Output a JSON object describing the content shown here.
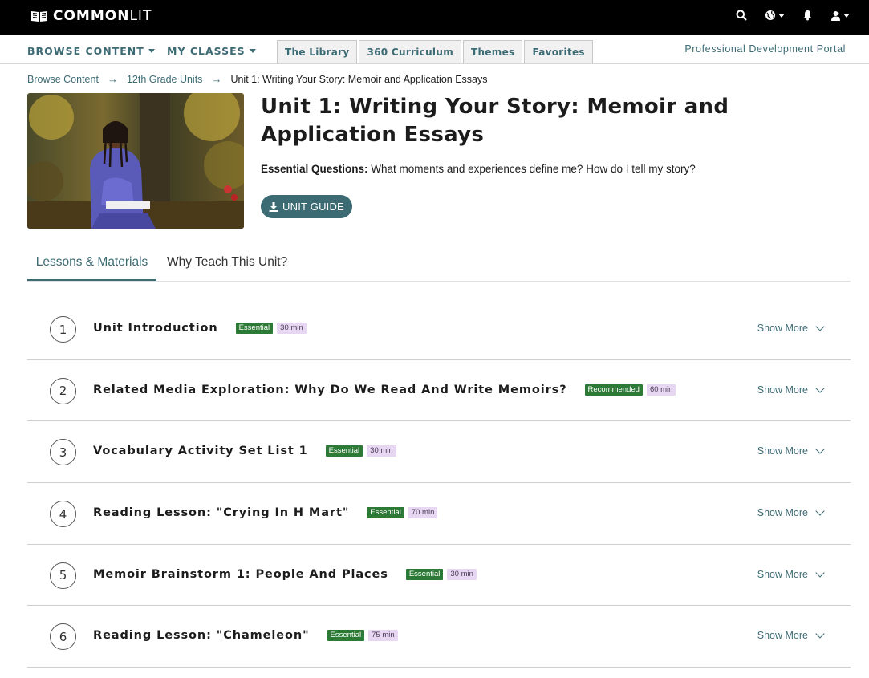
{
  "brand": {
    "name_bold": "COMMON",
    "name_light": "LIT"
  },
  "topbar_icons": [
    "search-icon",
    "globe-icon",
    "bell-icon",
    "user-icon"
  ],
  "nav": {
    "browse_content": "BROWSE CONTENT",
    "my_classes": "MY CLASSES",
    "tabs": [
      {
        "label": "The Library"
      },
      {
        "label": "360 Curriculum"
      },
      {
        "label": "Themes"
      },
      {
        "label": "Favorites"
      }
    ],
    "pd_portal": "Professional Development Portal"
  },
  "breadcrumb": {
    "items": [
      {
        "label": "Browse Content"
      },
      {
        "label": "12th Grade Units"
      },
      {
        "label": "Unit 1: Writing Your Story: Memoir and Application Essays"
      }
    ]
  },
  "unit": {
    "title": "Unit 1: Writing Your Story: Memoir and Application Essays",
    "essential_label": "Essential Questions:",
    "essential_text": " What moments and experiences define me? How do I tell my story?",
    "guide_label": "UNIT GUIDE"
  },
  "tabs": [
    {
      "label": "Lessons & Materials"
    },
    {
      "label": "Why Teach This Unit?"
    }
  ],
  "lessons": [
    {
      "num": "1",
      "title": "Unit Introduction",
      "type": "Essential",
      "time": "30 min",
      "show_more": "Show More"
    },
    {
      "num": "2",
      "title": "Related Media Exploration: Why Do We Read And Write Memoirs?",
      "type": "Recommended",
      "time": "60 min",
      "show_more": "Show More"
    },
    {
      "num": "3",
      "title": "Vocabulary Activity Set List 1",
      "type": "Essential",
      "time": "30 min",
      "show_more": "Show More"
    },
    {
      "num": "4",
      "title": "Reading Lesson: \"Crying In H Mart\"",
      "type": "Essential",
      "time": "70 min",
      "show_more": "Show More"
    },
    {
      "num": "5",
      "title": "Memoir Brainstorm 1: People And Places",
      "type": "Essential",
      "time": "30 min",
      "show_more": "Show More"
    },
    {
      "num": "6",
      "title": "Reading Lesson: \"Chameleon\"",
      "type": "Essential",
      "time": "75 min",
      "show_more": "Show More"
    }
  ],
  "colors": {
    "teal": "#3d6b74",
    "essential_green": "#2c7a35",
    "time_purple": "#e7d7f3"
  }
}
